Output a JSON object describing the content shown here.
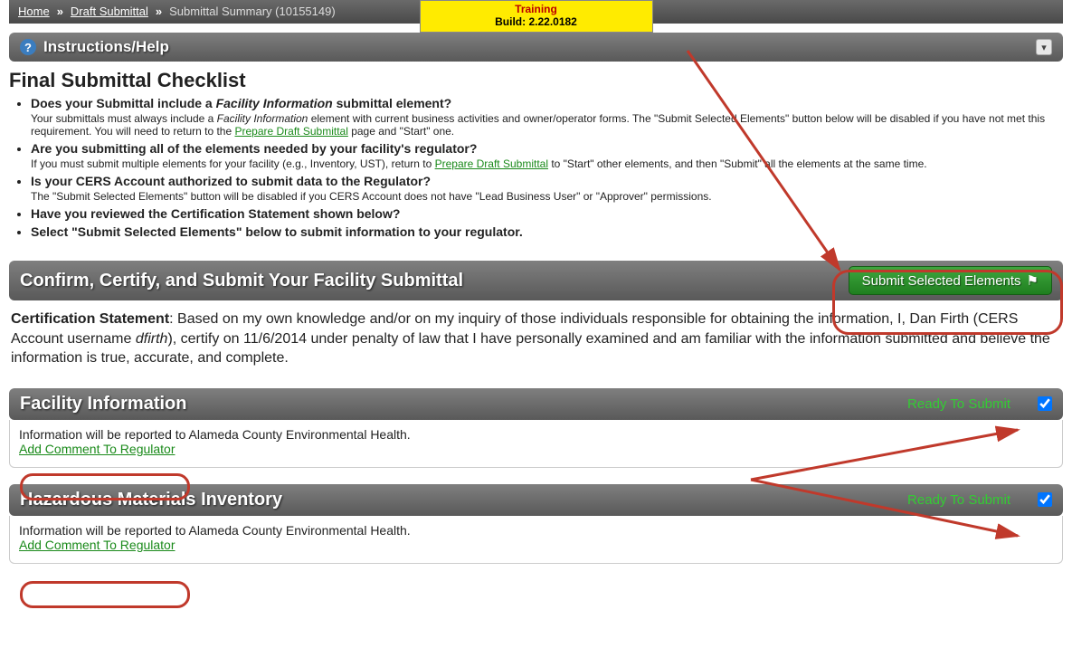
{
  "training": {
    "line1": "Training",
    "line2": "Build: 2.22.0182"
  },
  "breadcrumb": {
    "home": "Home",
    "draft": "Draft Submittal",
    "summary": "Submittal Summary (10155149)"
  },
  "instructions": {
    "title": "Instructions/Help",
    "heading": "Final Submittal Checklist",
    "items": [
      {
        "q_before": "Does your Submittal include a ",
        "q_italic": "Facility Information",
        "q_after": " submittal element?",
        "a_before": "Your submittals must always include a ",
        "a_italic": "Facility Information",
        "a_mid": " element with current business activities and owner/operator forms. The \"Submit Selected Elements\" button below will be disabled if you have not met this requirement. You will need to return to the ",
        "a_link": "Prepare Draft Submittal",
        "a_after": " page and \"Start\" one."
      },
      {
        "q": "Are you submitting all of the elements needed by your facility's regulator?",
        "a_before": "If you must submit multiple elements for your facility (e.g., Inventory, UST), return to ",
        "a_link": "Prepare Draft Submittal",
        "a_after": " to \"Start\" other elements, and then \"Submit\" all the elements at the same time."
      },
      {
        "q": "Is your CERS Account authorized to submit data to the Regulator?",
        "a": "The \"Submit Selected Elements\" button will be disabled if you CERS Account does not have \"Lead Business User\" or \"Approver\" permissions."
      },
      {
        "q": "Have you reviewed the Certification Statement shown below?"
      },
      {
        "q": "Select \"Submit Selected Elements\" below to submit information to your regulator."
      }
    ]
  },
  "confirm": {
    "title": "Confirm, Certify, and Submit Your Facility Submittal",
    "button": "Submit Selected Elements"
  },
  "certification": {
    "label": "Certification Statement",
    "text_before": ": Based on my own knowledge and/or on my inquiry of those individuals responsible for obtaining the information, I, Dan Firth (CERS Account username ",
    "username": "dfirth",
    "text_after": "), certify on 11/6/2014 under penalty of law that I have personally examined and am familiar with the information submitted and believe the information is true, accurate, and complete."
  },
  "elements": [
    {
      "title": "Facility Information",
      "status": "Ready To Submit",
      "body": "Information will be reported to Alameda County Environmental Health.",
      "link": "Add Comment To Regulator",
      "checked": true
    },
    {
      "title": "Hazardous Materials Inventory",
      "status": "Ready To Submit",
      "body": "Information will be reported to Alameda County Environmental Health.",
      "link": "Add Comment To Regulator",
      "checked": true
    }
  ]
}
